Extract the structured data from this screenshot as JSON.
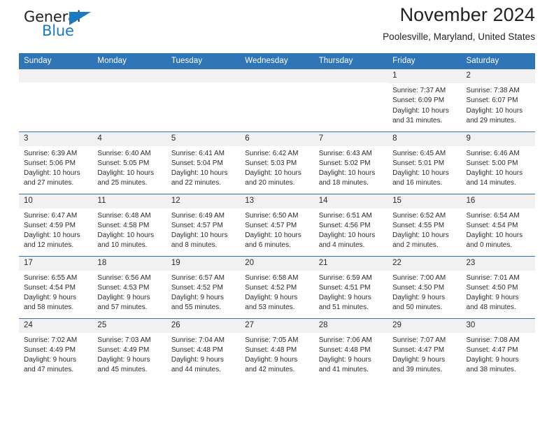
{
  "brand": {
    "word_one": "General",
    "word_two": "Blue",
    "triangle_icon": "triangle-icon"
  },
  "header": {
    "title": "November 2024",
    "subtitle": "Poolesville, Maryland, United States"
  },
  "colors": {
    "header_blue": "#3075b5",
    "daynum_gray": "#f1f1f1",
    "brand_blue": "#1c7ac0",
    "text": "#2b2b2b"
  },
  "labels": {
    "sunrise_prefix": "Sunrise:",
    "sunset_prefix": "Sunset:",
    "daylight_prefix": "Daylight:"
  },
  "weekdays": [
    "Sunday",
    "Monday",
    "Tuesday",
    "Wednesday",
    "Thursday",
    "Friday",
    "Saturday"
  ],
  "weeks": [
    [
      {
        "day": "",
        "empty": true
      },
      {
        "day": "",
        "empty": true
      },
      {
        "day": "",
        "empty": true
      },
      {
        "day": "",
        "empty": true
      },
      {
        "day": "",
        "empty": true
      },
      {
        "day": "1",
        "sunrise": "Sunrise: 7:37 AM",
        "sunset": "Sunset: 6:09 PM",
        "daylight_line1": "Daylight: 10 hours",
        "daylight_line2": "and 31 minutes."
      },
      {
        "day": "2",
        "sunrise": "Sunrise: 7:38 AM",
        "sunset": "Sunset: 6:07 PM",
        "daylight_line1": "Daylight: 10 hours",
        "daylight_line2": "and 29 minutes."
      }
    ],
    [
      {
        "day": "3",
        "sunrise": "Sunrise: 6:39 AM",
        "sunset": "Sunset: 5:06 PM",
        "daylight_line1": "Daylight: 10 hours",
        "daylight_line2": "and 27 minutes."
      },
      {
        "day": "4",
        "sunrise": "Sunrise: 6:40 AM",
        "sunset": "Sunset: 5:05 PM",
        "daylight_line1": "Daylight: 10 hours",
        "daylight_line2": "and 25 minutes."
      },
      {
        "day": "5",
        "sunrise": "Sunrise: 6:41 AM",
        "sunset": "Sunset: 5:04 PM",
        "daylight_line1": "Daylight: 10 hours",
        "daylight_line2": "and 22 minutes."
      },
      {
        "day": "6",
        "sunrise": "Sunrise: 6:42 AM",
        "sunset": "Sunset: 5:03 PM",
        "daylight_line1": "Daylight: 10 hours",
        "daylight_line2": "and 20 minutes."
      },
      {
        "day": "7",
        "sunrise": "Sunrise: 6:43 AM",
        "sunset": "Sunset: 5:02 PM",
        "daylight_line1": "Daylight: 10 hours",
        "daylight_line2": "and 18 minutes."
      },
      {
        "day": "8",
        "sunrise": "Sunrise: 6:45 AM",
        "sunset": "Sunset: 5:01 PM",
        "daylight_line1": "Daylight: 10 hours",
        "daylight_line2": "and 16 minutes."
      },
      {
        "day": "9",
        "sunrise": "Sunrise: 6:46 AM",
        "sunset": "Sunset: 5:00 PM",
        "daylight_line1": "Daylight: 10 hours",
        "daylight_line2": "and 14 minutes."
      }
    ],
    [
      {
        "day": "10",
        "sunrise": "Sunrise: 6:47 AM",
        "sunset": "Sunset: 4:59 PM",
        "daylight_line1": "Daylight: 10 hours",
        "daylight_line2": "and 12 minutes."
      },
      {
        "day": "11",
        "sunrise": "Sunrise: 6:48 AM",
        "sunset": "Sunset: 4:58 PM",
        "daylight_line1": "Daylight: 10 hours",
        "daylight_line2": "and 10 minutes."
      },
      {
        "day": "12",
        "sunrise": "Sunrise: 6:49 AM",
        "sunset": "Sunset: 4:57 PM",
        "daylight_line1": "Daylight: 10 hours",
        "daylight_line2": "and 8 minutes."
      },
      {
        "day": "13",
        "sunrise": "Sunrise: 6:50 AM",
        "sunset": "Sunset: 4:57 PM",
        "daylight_line1": "Daylight: 10 hours",
        "daylight_line2": "and 6 minutes."
      },
      {
        "day": "14",
        "sunrise": "Sunrise: 6:51 AM",
        "sunset": "Sunset: 4:56 PM",
        "daylight_line1": "Daylight: 10 hours",
        "daylight_line2": "and 4 minutes."
      },
      {
        "day": "15",
        "sunrise": "Sunrise: 6:52 AM",
        "sunset": "Sunset: 4:55 PM",
        "daylight_line1": "Daylight: 10 hours",
        "daylight_line2": "and 2 minutes."
      },
      {
        "day": "16",
        "sunrise": "Sunrise: 6:54 AM",
        "sunset": "Sunset: 4:54 PM",
        "daylight_line1": "Daylight: 10 hours",
        "daylight_line2": "and 0 minutes."
      }
    ],
    [
      {
        "day": "17",
        "sunrise": "Sunrise: 6:55 AM",
        "sunset": "Sunset: 4:54 PM",
        "daylight_line1": "Daylight: 9 hours",
        "daylight_line2": "and 58 minutes."
      },
      {
        "day": "18",
        "sunrise": "Sunrise: 6:56 AM",
        "sunset": "Sunset: 4:53 PM",
        "daylight_line1": "Daylight: 9 hours",
        "daylight_line2": "and 57 minutes."
      },
      {
        "day": "19",
        "sunrise": "Sunrise: 6:57 AM",
        "sunset": "Sunset: 4:52 PM",
        "daylight_line1": "Daylight: 9 hours",
        "daylight_line2": "and 55 minutes."
      },
      {
        "day": "20",
        "sunrise": "Sunrise: 6:58 AM",
        "sunset": "Sunset: 4:52 PM",
        "daylight_line1": "Daylight: 9 hours",
        "daylight_line2": "and 53 minutes."
      },
      {
        "day": "21",
        "sunrise": "Sunrise: 6:59 AM",
        "sunset": "Sunset: 4:51 PM",
        "daylight_line1": "Daylight: 9 hours",
        "daylight_line2": "and 51 minutes."
      },
      {
        "day": "22",
        "sunrise": "Sunrise: 7:00 AM",
        "sunset": "Sunset: 4:50 PM",
        "daylight_line1": "Daylight: 9 hours",
        "daylight_line2": "and 50 minutes."
      },
      {
        "day": "23",
        "sunrise": "Sunrise: 7:01 AM",
        "sunset": "Sunset: 4:50 PM",
        "daylight_line1": "Daylight: 9 hours",
        "daylight_line2": "and 48 minutes."
      }
    ],
    [
      {
        "day": "24",
        "sunrise": "Sunrise: 7:02 AM",
        "sunset": "Sunset: 4:49 PM",
        "daylight_line1": "Daylight: 9 hours",
        "daylight_line2": "and 47 minutes."
      },
      {
        "day": "25",
        "sunrise": "Sunrise: 7:03 AM",
        "sunset": "Sunset: 4:49 PM",
        "daylight_line1": "Daylight: 9 hours",
        "daylight_line2": "and 45 minutes."
      },
      {
        "day": "26",
        "sunrise": "Sunrise: 7:04 AM",
        "sunset": "Sunset: 4:48 PM",
        "daylight_line1": "Daylight: 9 hours",
        "daylight_line2": "and 44 minutes."
      },
      {
        "day": "27",
        "sunrise": "Sunrise: 7:05 AM",
        "sunset": "Sunset: 4:48 PM",
        "daylight_line1": "Daylight: 9 hours",
        "daylight_line2": "and 42 minutes."
      },
      {
        "day": "28",
        "sunrise": "Sunrise: 7:06 AM",
        "sunset": "Sunset: 4:48 PM",
        "daylight_line1": "Daylight: 9 hours",
        "daylight_line2": "and 41 minutes."
      },
      {
        "day": "29",
        "sunrise": "Sunrise: 7:07 AM",
        "sunset": "Sunset: 4:47 PM",
        "daylight_line1": "Daylight: 9 hours",
        "daylight_line2": "and 39 minutes."
      },
      {
        "day": "30",
        "sunrise": "Sunrise: 7:08 AM",
        "sunset": "Sunset: 4:47 PM",
        "daylight_line1": "Daylight: 9 hours",
        "daylight_line2": "and 38 minutes."
      }
    ]
  ]
}
